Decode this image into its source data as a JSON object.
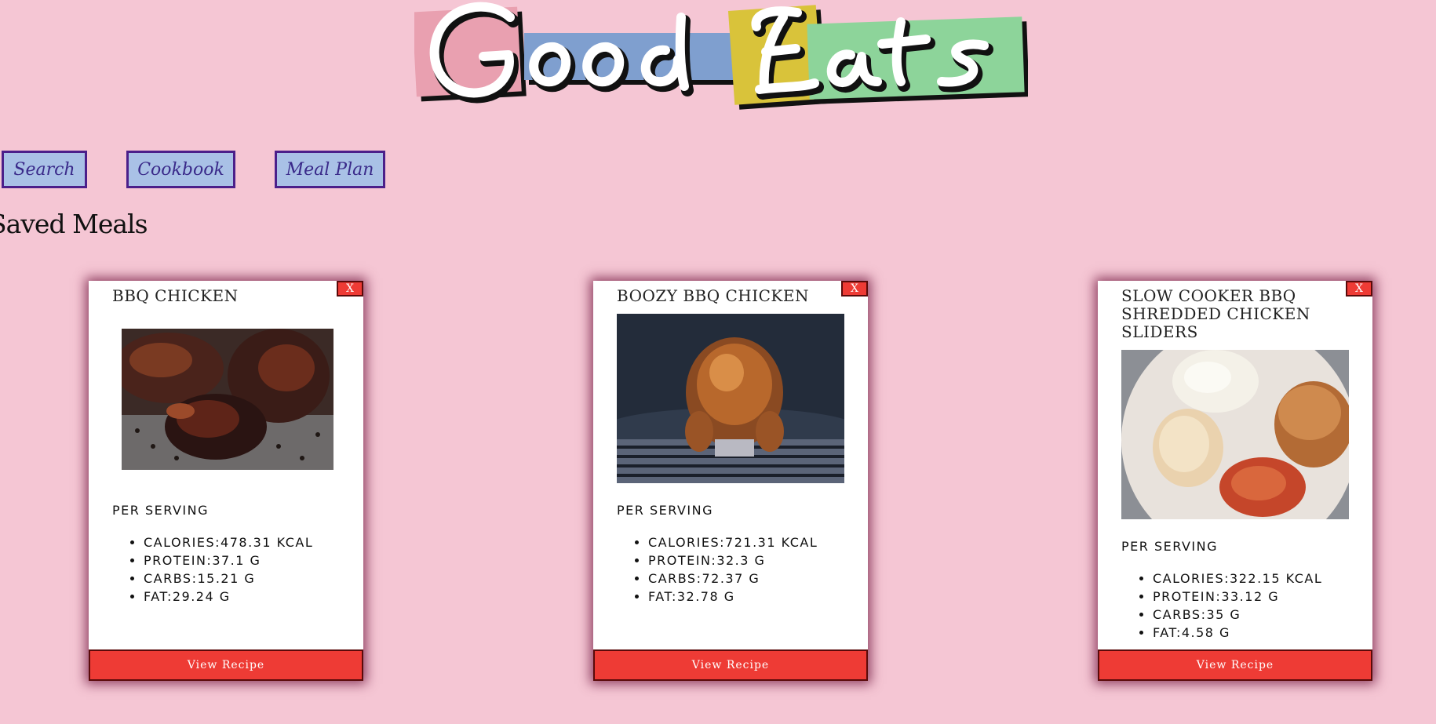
{
  "app": {
    "logo_text": "Good Eats"
  },
  "nav": {
    "search_label": "Search",
    "cookbook_label": "Cookbook",
    "meal_plan_label": "Meal Plan"
  },
  "section_title": "Saved Meals",
  "cards": [
    {
      "title": "BBQ Chicken",
      "close_label": "X",
      "per_serving_label": "Per Serving",
      "nutrients": [
        "Calories:478.31 kcal",
        "Protein:37.1 g",
        "Carbs:15.21 g",
        "Fat:29.24 g"
      ],
      "view_label": "View Recipe"
    },
    {
      "title": "Boozy BBQ Chicken",
      "close_label": "X",
      "per_serving_label": "Per Serving",
      "nutrients": [
        "Calories:721.31 kcal",
        "Protein:32.3 g",
        "Carbs:72.37 g",
        "Fat:32.78 g"
      ],
      "view_label": "View Recipe"
    },
    {
      "title": "Slow Cooker BBQ Shredded Chicken Sliders",
      "close_label": "X",
      "per_serving_label": "Per Serving",
      "nutrients": [
        "Calories:322.15 kcal",
        "Protein:33.12 g",
        "Carbs:35 g",
        "Fat:4.58 g"
      ],
      "view_label": "View Recipe"
    }
  ],
  "colors": {
    "page_background": "#f5c6d4",
    "nav_button_fill": "#a9c1e6",
    "nav_button_border": "#4b1f8a",
    "accent_red": "#ee3b35",
    "logo_pink": "#e9a0b0",
    "logo_blue": "#7f9fcf",
    "logo_yellow": "#d9c33a",
    "logo_green": "#8dd49a"
  }
}
